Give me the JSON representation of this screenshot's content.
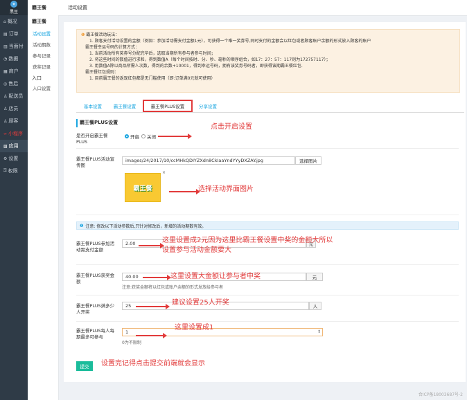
{
  "sidebar": {
    "brand": "黑豆",
    "items": [
      {
        "icon": "home-icon",
        "glyph": "⌂",
        "label": "概况"
      },
      {
        "icon": "order-icon",
        "glyph": "▤",
        "label": "订单"
      },
      {
        "icon": "store-icon",
        "glyph": "▥",
        "label": "当面付"
      },
      {
        "icon": "data-icon",
        "glyph": "◔",
        "label": "数据"
      },
      {
        "icon": "goods-icon",
        "glyph": "▦",
        "label": "商户"
      },
      {
        "icon": "aftersale-icon",
        "glyph": "◎",
        "label": "售后"
      },
      {
        "icon": "delivery-icon",
        "glyph": "♙",
        "label": "配送员"
      },
      {
        "icon": "staff-icon",
        "glyph": "♙",
        "label": "店员"
      },
      {
        "icon": "customer-icon",
        "glyph": "♙",
        "label": "顾客"
      },
      {
        "icon": "program-icon",
        "glyph": "∞",
        "label": "小程序"
      },
      {
        "icon": "apps-icon",
        "glyph": "▧",
        "label": "应用"
      },
      {
        "icon": "settings-icon",
        "glyph": "⚙",
        "label": "设置"
      },
      {
        "icon": "permission-icon",
        "glyph": "⚿",
        "label": "权限"
      }
    ]
  },
  "topbar": {
    "module": "霸王餐",
    "page": "活动设置"
  },
  "subnav": {
    "title": "霸王餐",
    "items": [
      "活动设置",
      "活动期数",
      "参与记录",
      "获奖记录"
    ],
    "group": "入口",
    "group_items": [
      "入口设置"
    ]
  },
  "notice": {
    "lines": [
      "霸王餐活动玩法：",
      "1. 顾客支付活动设置的金额（例如：参加活动需支付金额1元），可获得一个唯一奖券号,同时支付的金额会以红包或者顾客账户余额的形式放入顾客的账户",
      "霸王餐幸运号码的计算方式：",
      "1. 当前活动所有奖券号分配完毕后，选取当期所有参与者参与时间；",
      "2. 将这些时间的数值进行求和，得到数值A（每个时间按时、分、秒、毫秒的顺序组合，如17：27：57：117则为172757117）；",
      "3. 用数值A除以商品所需人次数，得到的余数+10001，得到幸运号码，拥有该奖券号码者，即获得该期霸王餐红包.",
      "霸王餐红包规则：",
      "1. 目前霸王餐的返现红包都是无门槛使用（即:订单满0元就可使用）"
    ]
  },
  "tabs": [
    "基本设置",
    "霸王餐设置",
    "霸王餐PLUS设置",
    "分享设置"
  ],
  "section_title": "霸王餐PLUS设置",
  "form": {
    "open_label": "是否开启霸王餐PLUS",
    "open_on": "开启",
    "open_off": "关闭",
    "cover_label": "霸王餐PLUS活动宣传图",
    "cover_path": "images/24/2017/10/ccMHkQDIYZXdn8CkIaaYndYYyDXZAY.jpg",
    "cover_button": "选择图片",
    "cover_thumb_text": "霸王餐",
    "remove_mark": "×",
    "info_bar": "注意: 修改以下活动参数后,只针对修改后，新增的活动期数有效。",
    "join_label": "霸王餐PLUS参加活动需支付金额",
    "join_value": "2.00",
    "join_unit": "元",
    "prize_label": "霸王餐PLUS获奖金额",
    "prize_value": "40.00",
    "prize_unit": "元",
    "prize_hint": "注意:获奖金额将以红包或账户余额的形式发放给参与者",
    "full_label": "霸王餐PLUS满多少人开奖",
    "full_value": "25",
    "full_unit": "人",
    "limit_label": "霸王餐PLUS每人每期最多可参与",
    "limit_value": "1",
    "limit_hint": "0为不限制",
    "submit": "提交"
  },
  "annotations": {
    "a1": "点击开启设置",
    "a2": "选择活动界面图片",
    "a3": "这里设置成2元因为这里比霸王餐设置中奖的金额大所以",
    "a3b": "设置参与活动金额要大",
    "a4": "这里设置大金额让参与者中奖",
    "a5": "建议设置25人开奖",
    "a6": "这里设置成1",
    "a7": "设置完记得点击提交前端就会显示"
  },
  "footer": "合ICP备18003687号-2",
  "colors": {
    "accent": "#19a5e0",
    "annotation": "#e23b3b",
    "submit": "#1bbc9b"
  }
}
